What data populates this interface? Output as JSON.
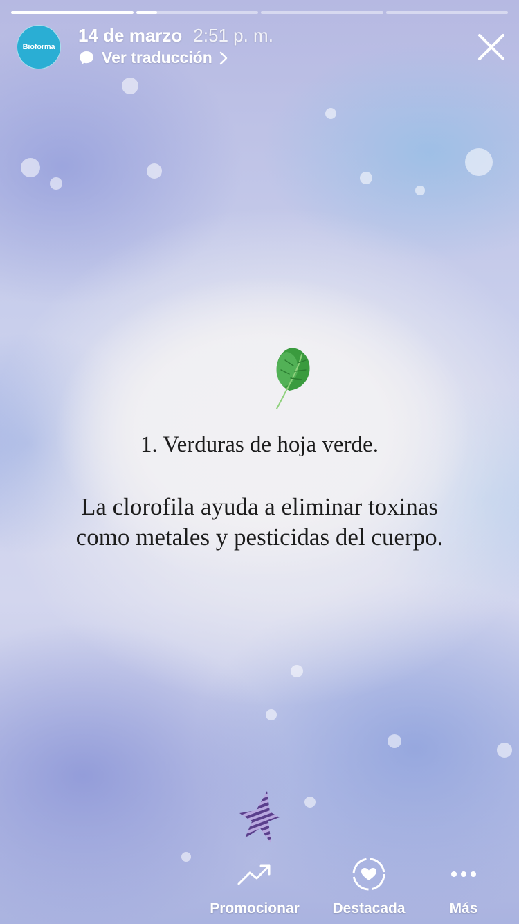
{
  "progress": {
    "segments": [
      1,
      0.17,
      0,
      0
    ]
  },
  "header": {
    "avatar_label": "Bioforma",
    "date": "14 de marzo",
    "time": "2:51 p. m.",
    "translate_label": "Ver traducción"
  },
  "content": {
    "title": "1. Verduras de hoja verde.",
    "body_line_1": "La clorofila ayuda a eliminar toxinas",
    "body_line_2": "como metales y pesticidas del cuerpo."
  },
  "actions": {
    "promote_label": "Promocionar",
    "highlight_label": "Destacada",
    "more_label": "Más"
  },
  "icons": {
    "close": "close-icon",
    "chat_bubble": "chat-bubble-icon",
    "chevron": "chevron-right-icon",
    "leaf": "leaf-icon",
    "star_sticker": "star-sticker-icon",
    "trend": "trend-up-icon",
    "highlight": "heart-circle-icon",
    "more": "more-dots-icon"
  },
  "colors": {
    "avatar_bg": "#2aaed4",
    "text_dark": "#1c1c1c",
    "leaf_green": "#3a9b3e"
  }
}
